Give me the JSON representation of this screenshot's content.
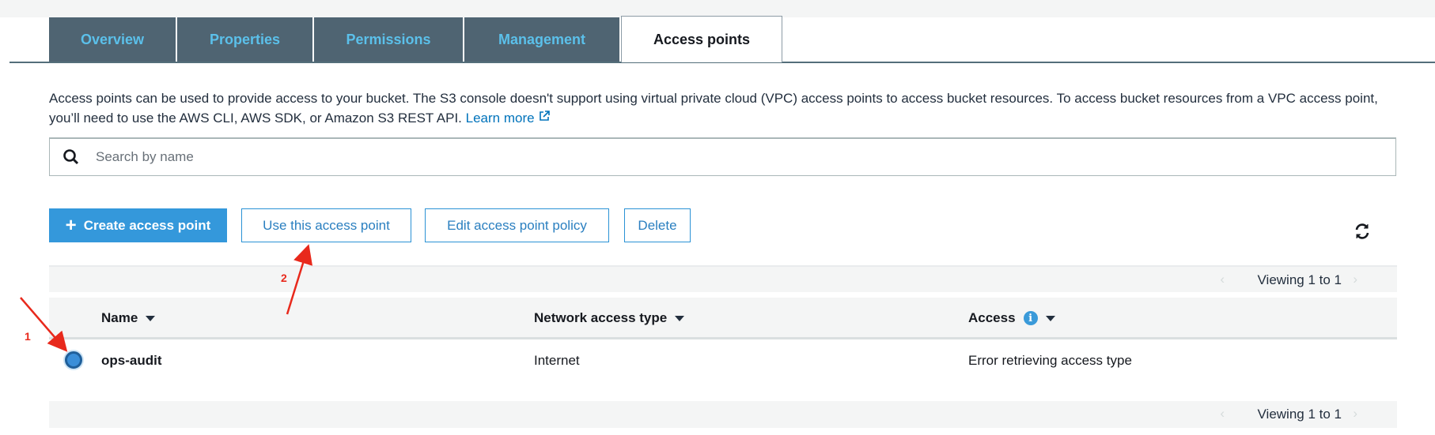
{
  "tabs": [
    {
      "label": "Overview",
      "active": false
    },
    {
      "label": "Properties",
      "active": false
    },
    {
      "label": "Permissions",
      "active": false
    },
    {
      "label": "Management",
      "active": false
    },
    {
      "label": "Access points",
      "active": true
    }
  ],
  "description": {
    "text": "Access points can be used to provide access to your bucket. The S3 console doesn't support using virtual private cloud (VPC) access points to access bucket resources. To access bucket resources from a VPC access point, you’ll need to use the AWS CLI, AWS SDK, or Amazon S3 REST API.",
    "link": "Learn more"
  },
  "search": {
    "placeholder": "Search by name",
    "value": ""
  },
  "toolbar": {
    "create": "Create access point",
    "use": "Use this access point",
    "edit_policy": "Edit access point policy",
    "delete": "Delete"
  },
  "pagination": {
    "top": "Viewing 1 to 1",
    "bottom": "Viewing 1 to 1"
  },
  "table": {
    "columns": [
      "Name",
      "Network access type",
      "Access"
    ],
    "rows": [
      {
        "name": "ops-audit",
        "network": "Internet",
        "access": "Error retrieving access type",
        "selected": true
      }
    ]
  },
  "annotations": {
    "step1": "1",
    "step2": "2"
  },
  "colors": {
    "tab_bg": "#4f6472",
    "tab_text": "#5bc0ea",
    "primary": "#3498db",
    "annotation": "#e8291c"
  }
}
